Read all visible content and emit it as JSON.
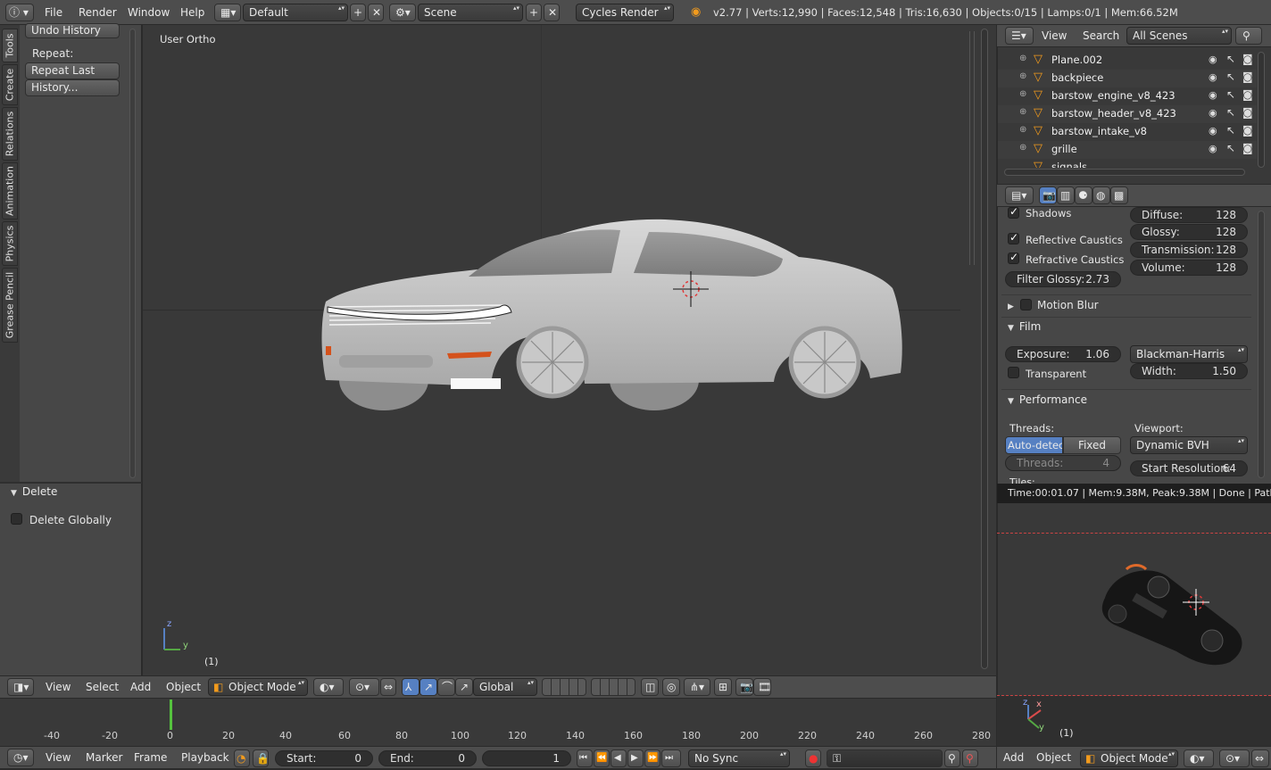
{
  "top_bar": {
    "menus": [
      "File",
      "Render",
      "Window",
      "Help"
    ],
    "layout": "Default",
    "scene": "Scene",
    "engine": "Cycles Render",
    "stats": "v2.77 | Verts:12,990 | Faces:12,548 | Tris:16,630 | Objects:0/15 | Lamps:0/1 | Mem:66.52M"
  },
  "tool_shelf": {
    "tabs": [
      "Tools",
      "Create",
      "Relations",
      "Animation",
      "Physics",
      "Grease Pencil"
    ],
    "undo_history": "Undo History",
    "repeat_label": "Repeat:",
    "repeat_last": "Repeat Last",
    "history": "History...",
    "delete_panel": "Delete",
    "delete_globally": "Delete Globally"
  },
  "viewport": {
    "view_label": "User Ortho",
    "frame_label": "(1)",
    "axis_z": "z",
    "axis_y": "y"
  },
  "viewport_header": {
    "menus": [
      "View",
      "Select",
      "Add",
      "Object"
    ],
    "mode": "Object Mode",
    "orientation": "Global"
  },
  "timeline": {
    "ticks": [
      "-40",
      "-20",
      "0",
      "20",
      "40",
      "60",
      "80",
      "100",
      "120",
      "140",
      "160",
      "180",
      "200",
      "220",
      "240",
      "260",
      "280"
    ],
    "current_frame": "1",
    "menus": [
      "View",
      "Marker",
      "Frame",
      "Playback"
    ],
    "start_label": "Start:",
    "start": "0",
    "end_label": "End:",
    "end": "0",
    "frame": "1",
    "sync": "No Sync"
  },
  "outliner": {
    "menus": [
      "View",
      "Search"
    ],
    "filter": "All Scenes",
    "items": [
      {
        "name": "Plane.002"
      },
      {
        "name": "backpiece"
      },
      {
        "name": "barstow_engine_v8_423"
      },
      {
        "name": "barstow_header_v8_423"
      },
      {
        "name": "barstow_intake_v8"
      },
      {
        "name": "grille"
      },
      {
        "name": "signals"
      }
    ]
  },
  "properties": {
    "shadows": "Shadows",
    "reflective_caustics": "Reflective Caustics",
    "refractive_caustics": "Refractive Caustics",
    "filter_glossy_label": "Filter Glossy:",
    "filter_glossy": "2.73",
    "bounces": [
      {
        "label": "Diffuse:",
        "value": "128"
      },
      {
        "label": "Glossy:",
        "value": "128"
      },
      {
        "label": "Transmission:",
        "value": "128"
      },
      {
        "label": "Volume:",
        "value": "128"
      }
    ],
    "motion_blur": "Motion Blur",
    "film": "Film",
    "exposure_label": "Exposure:",
    "exposure": "1.06",
    "filter_type": "Blackman-Harris",
    "transparent": "Transparent",
    "width_label": "Width:",
    "width": "1.50",
    "performance": "Performance",
    "threads_label": "Threads:",
    "auto_detect": "Auto-detect",
    "fixed": "Fixed",
    "threads_field": "Threads:",
    "threads_value": "4",
    "viewport_label": "Viewport:",
    "bvh": "Dynamic BVH",
    "start_res_label": "Start Resolution:",
    "start_res": "64",
    "tiles": "Tiles:"
  },
  "render_preview": {
    "info": "Time:00:01.07 | Mem:9.38M, Peak:9.38M | Done | Path Tra",
    "frame_label": "(1)",
    "axis_x": "x",
    "axis_y": "y",
    "axis_z": "z",
    "menus": [
      "Add",
      "Object"
    ],
    "mode": "Object Mode"
  },
  "colors": {
    "accent": "#5680c2",
    "header": "#4d4d4d",
    "viewport": "#393939",
    "panel": "#474747",
    "orange": "#f29b1d"
  }
}
